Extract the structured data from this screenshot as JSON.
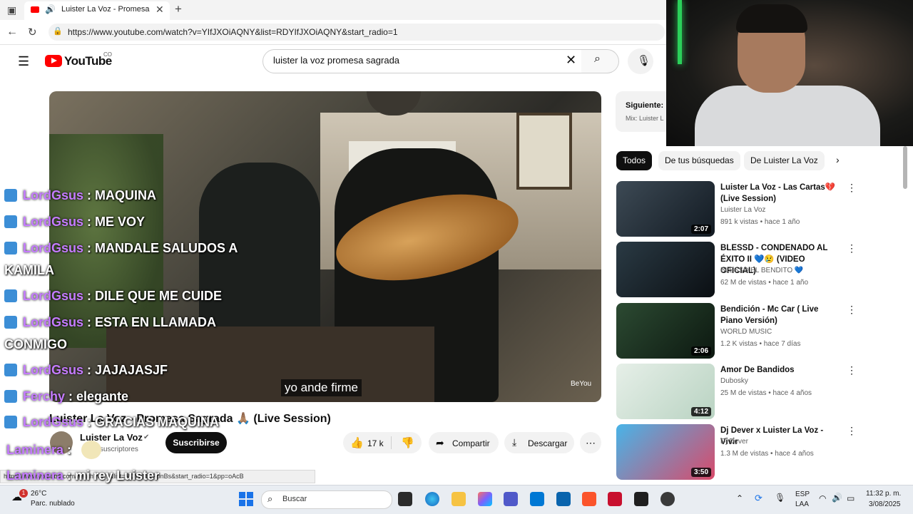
{
  "browser": {
    "tab_title": "Luister La Voz - Promesa Sagrada",
    "url": "https://www.youtube.com/watch?v=YIfJXOiAQNY&list=RDYIfJXOiAQNY&start_radio=1"
  },
  "youtube": {
    "logo_text": "YouTube",
    "country": "CO",
    "search_query": "luister la voz promesa sagrada"
  },
  "video": {
    "watermark": "BeYou",
    "subtitle": "yo ande firme",
    "title": "Luister La Voz - Promesa Sagrada 🙏🏽 (Live Session)",
    "channel": "Luister La Voz",
    "subs": "suscriptores",
    "subscribe_label": "Suscribirse",
    "likes": "17 k",
    "share_label": "Compartir",
    "download_label": "Descargar",
    "status_url": "https://www.youtube.com/watch?v=...&list=RDYkBrEFpnBs&start_radio=1&pp=oAcB"
  },
  "chat": [
    {
      "user": "LordGsus",
      "msg": "MAQUINA"
    },
    {
      "user": "LordGsus",
      "msg": "ME VOY"
    },
    {
      "user": "LordGsus",
      "msg": "MANDALE SALUDOS A",
      "cont": "KAMILA"
    },
    {
      "user": "LordGsus",
      "msg": "DILE QUE ME CUIDE"
    },
    {
      "user": "LordGsus",
      "msg": "ESTA EN LLAMADA",
      "cont": "CONMIGO"
    },
    {
      "user": "LordGsus",
      "msg": "JAJAJASJF"
    },
    {
      "user": "Ferchy",
      "msg": "elegante"
    },
    {
      "user": "LordGsus",
      "msg": "GRACIAS MAQUINA"
    },
    {
      "user": "Laminera",
      "msg": ""
    },
    {
      "user": "Laminera",
      "msg": "mi rey Luister"
    }
  ],
  "next_panel": {
    "label": "Siguiente:",
    "sub": "Mix: Luister L"
  },
  "chips": [
    "Todos",
    "De tus búsquedas",
    "De Luister La Voz"
  ],
  "related": [
    {
      "title": "Luister La Voz - Las Cartas💔 (Live Session)",
      "channel": "Luister La Voz",
      "meta": "891 k vistas • hace 1 año",
      "duration": "2:07"
    },
    {
      "title": "BLESSD - CONDENADO AL ÉXITO II 💙😢 (VIDEO OFICIAL)",
      "channel": "BLESSD EL BENDITO 💙",
      "meta": "62 M de vistas • hace 1 año",
      "duration": ""
    },
    {
      "title": "Bendición - Mc Car ( Live Piano Versión)",
      "channel": "WORLD MUSIC",
      "meta": "1.2 K vistas • hace 7 días",
      "duration": "2:06"
    },
    {
      "title": "Amor De Bandidos",
      "channel": "Dubosky",
      "meta": "25 M de vistas • hace 4 años",
      "duration": "4:12"
    },
    {
      "title": "Dj Dever x Luister La Voz - Vivir",
      "channel": "Dj Dever",
      "meta": "1.3 M de vistas • hace 4 años",
      "duration": "3:50"
    }
  ],
  "taskbar": {
    "temp": "26°C",
    "weather": "Parc. nublado",
    "search": "Buscar",
    "lang1": "ESP",
    "lang2": "LAA",
    "time": "11:32 p. m.",
    "date": "3/08/2025",
    "badge": "1"
  },
  "colors": {
    "accent": "#ff0000",
    "chat_user": "#c57bff",
    "chat_badge": "#3c8ed6"
  }
}
